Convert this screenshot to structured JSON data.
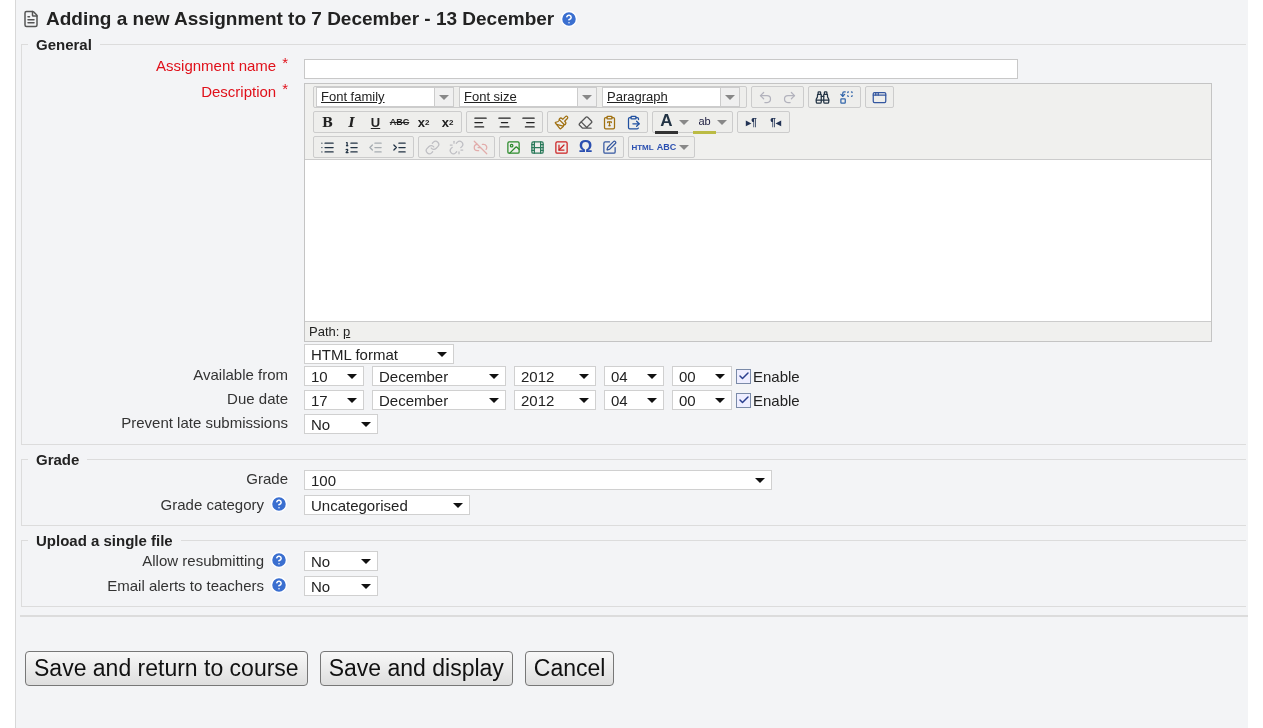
{
  "heading": {
    "title": "Adding a new Assignment to 7 December - 13 December"
  },
  "sections": [
    {
      "legend": "General",
      "rows": [
        {
          "kind": "text",
          "label": "Assignment name",
          "required": true,
          "required_mark": "*",
          "value": ""
        },
        {
          "kind": "editor",
          "label": "Description",
          "required": true,
          "required_mark": "*"
        }
      ]
    }
  ],
  "editor": {
    "toolbar": [
      [
        [
          {
            "kind": "select",
            "label": "Font family"
          },
          {
            "kind": "select",
            "label": "Font size"
          },
          {
            "kind": "select",
            "label": "Paragraph"
          }
        ],
        [
          {
            "kind": "undo",
            "disabled": true
          },
          {
            "kind": "redo",
            "disabled": true
          }
        ],
        [
          {
            "kind": "find",
            "disabled": false
          },
          {
            "kind": "replace",
            "disabled": false
          }
        ],
        [
          {
            "kind": "fullscreen",
            "disabled": false
          }
        ]
      ],
      [
        [
          {
            "kind": "bold",
            "label": "B"
          },
          {
            "kind": "italic",
            "label": "I"
          },
          {
            "kind": "underline",
            "label": "U"
          },
          {
            "kind": "strike",
            "label": "ABC"
          },
          {
            "kind": "sub",
            "label": "x",
            "mark": "2"
          },
          {
            "kind": "sup",
            "label": "x",
            "mark": "2"
          }
        ],
        [
          {
            "kind": "alignleft",
            "disabled": false
          },
          {
            "kind": "aligncenter",
            "disabled": false
          },
          {
            "kind": "alignright",
            "disabled": false
          }
        ],
        [
          {
            "kind": "brush",
            "disabled": false
          },
          {
            "kind": "eraser",
            "disabled": false
          },
          {
            "kind": "pastetext",
            "disabled": false
          },
          {
            "kind": "pasteword",
            "disabled": false
          }
        ],
        [
          {
            "kind": "color",
            "label": "A"
          },
          {
            "kind": "highlight",
            "label": "ab"
          }
        ],
        [
          {
            "kind": "plain",
            "label": "▸¶"
          },
          {
            "kind": "plain",
            "label": "¶◂"
          }
        ]
      ],
      [
        [
          {
            "kind": "bullets",
            "disabled": false
          },
          {
            "kind": "numbers",
            "disabled": false
          },
          {
            "kind": "outdent",
            "disabled": true
          },
          {
            "kind": "indent",
            "disabled": false
          }
        ],
        [
          {
            "kind": "link",
            "disabled": true
          },
          {
            "kind": "unlink",
            "disabled": true
          },
          {
            "kind": "anchor",
            "disabled": true
          }
        ],
        [
          {
            "kind": "image",
            "disabled": false
          },
          {
            "kind": "media",
            "disabled": false
          },
          {
            "kind": "pagebreak",
            "disabled": false
          },
          {
            "kind": "omega",
            "label": "Ω"
          },
          {
            "kind": "table",
            "disabled": false
          }
        ],
        [
          {
            "kind": "html",
            "label": "HTML"
          },
          {
            "kind": "spell",
            "label": "ABC"
          }
        ]
      ]
    ],
    "path_label": "Path:",
    "path_value": "p",
    "format": "HTML format"
  },
  "dates": [
    {
      "label": "Available from",
      "day": "10",
      "month": "December",
      "year": "2012",
      "hour": "04",
      "minute": "00",
      "enabled": true,
      "enable_label": "Enable"
    },
    {
      "label": "Due date",
      "day": "17",
      "month": "December",
      "year": "2012",
      "hour": "04",
      "minute": "00",
      "enabled": true,
      "enable_label": "Enable"
    }
  ],
  "late": {
    "label": "Prevent late submissions",
    "value": "No"
  },
  "grade": {
    "legend": "Grade",
    "rows": [
      {
        "label": "Grade",
        "value": "100",
        "help": false,
        "wide": true
      },
      {
        "label": "Grade category",
        "value": "Uncategorised",
        "help": true,
        "wide": false
      }
    ]
  },
  "upload": {
    "legend": "Upload a single file",
    "rows": [
      {
        "label": "Allow resubmitting",
        "value": "No",
        "help": true,
        "wide": false
      },
      {
        "label": "Email alerts to teachers",
        "value": "No",
        "help": true,
        "wide": false
      }
    ]
  },
  "buttons": [
    "Save and return to course",
    "Save and display",
    "Cancel"
  ]
}
